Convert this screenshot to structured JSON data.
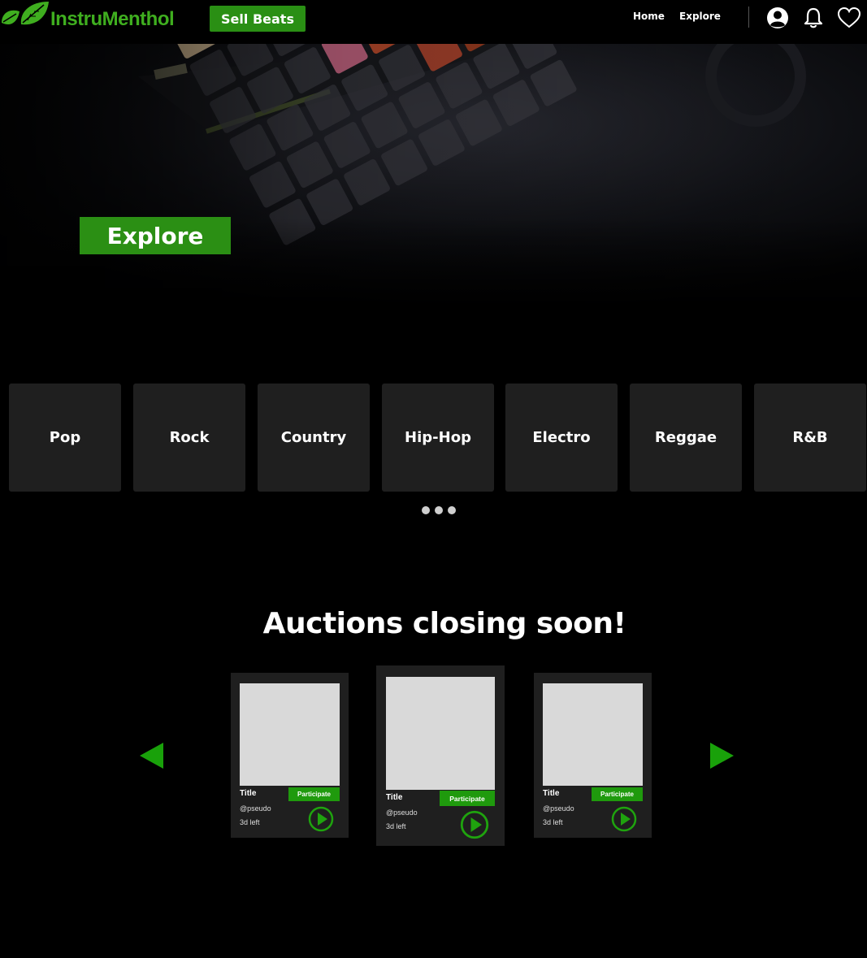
{
  "header": {
    "brand": "InstruMenthol",
    "sell_label": "Sell Beats",
    "nav": [
      "Home",
      "Explore"
    ],
    "icons": [
      "account-icon",
      "bell-icon",
      "heart-icon"
    ]
  },
  "hero": {
    "cta_label": "Explore"
  },
  "genres": [
    "Pop",
    "Rock",
    "Country",
    "Hip-Hop",
    "Electro",
    "Reggae",
    "R&B"
  ],
  "carousel": {
    "dots_count": 3
  },
  "auctions": {
    "heading": "Auctions closing soon!",
    "cards": [
      {
        "title": "Title",
        "user": "@pseudo",
        "time": "3d left",
        "action": "Participate"
      },
      {
        "title": "Title",
        "user": "@pseudo",
        "time": "3d left",
        "action": "Participate"
      },
      {
        "title": "Title",
        "user": "@pseudo",
        "time": "3d left",
        "action": "Participate"
      }
    ]
  },
  "colors": {
    "background": "#000000",
    "brand_green": "#3fae1f",
    "button_green": "#2a8f14",
    "tile": "#1f1f1f",
    "placeholder": "#d9d9d9"
  }
}
